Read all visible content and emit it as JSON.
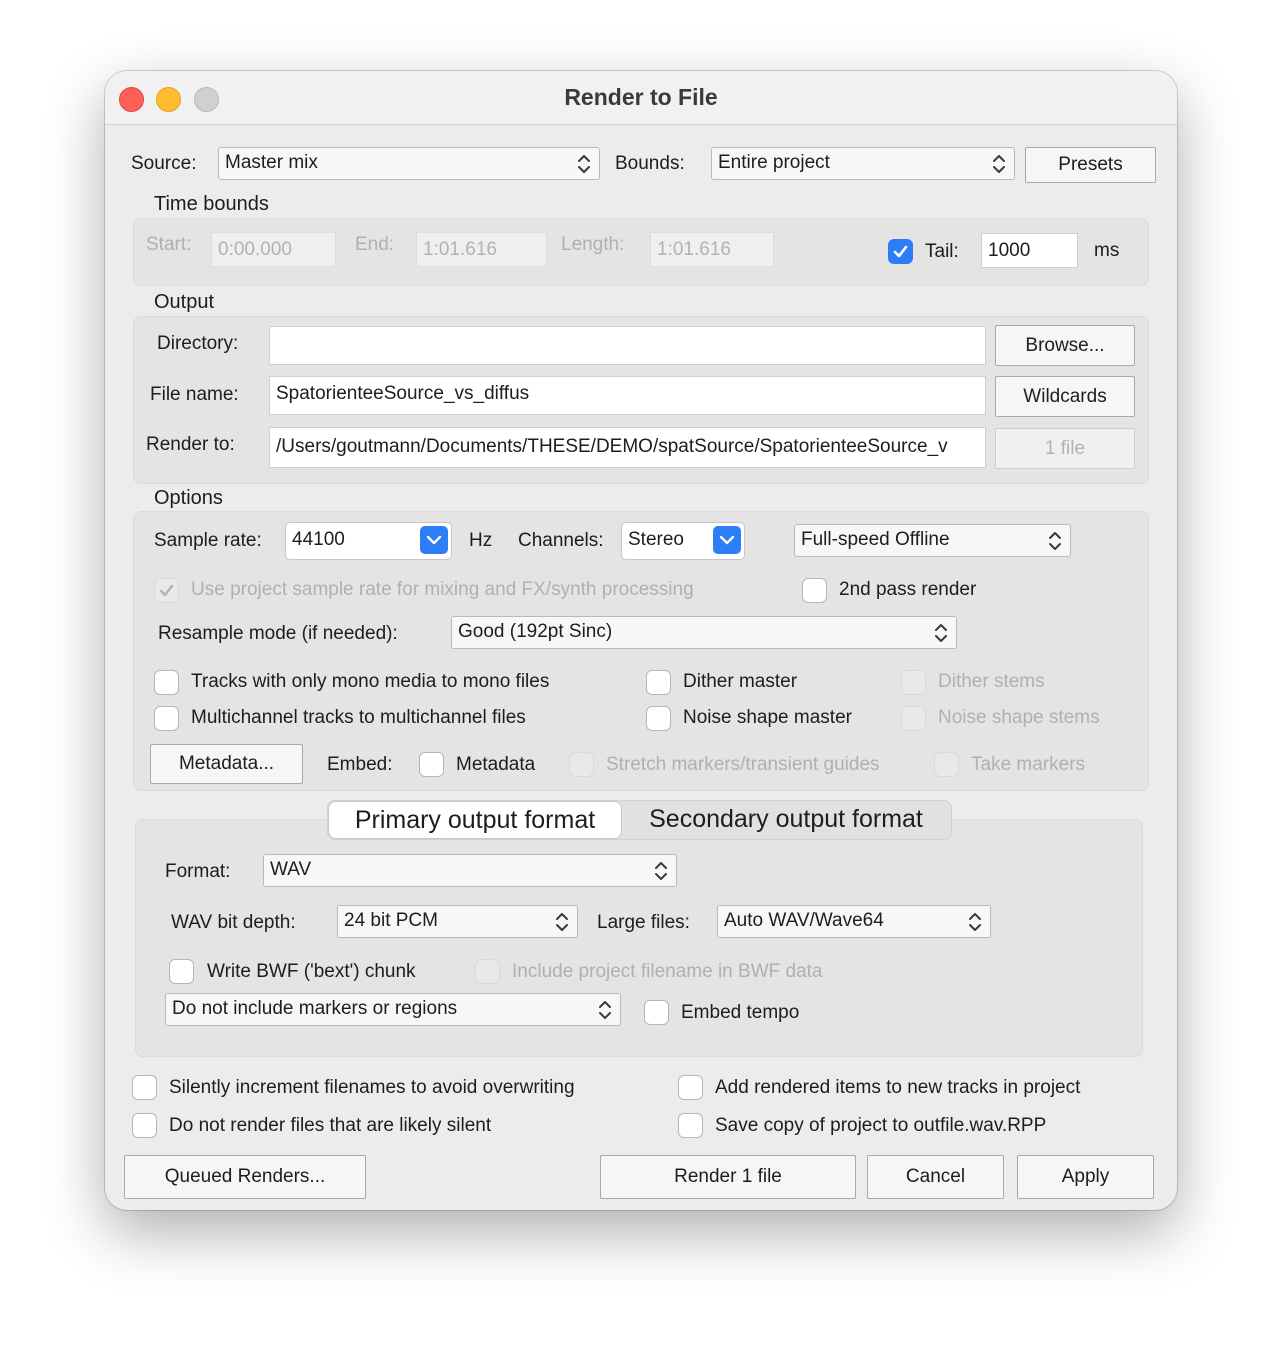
{
  "window": {
    "title": "Render to File"
  },
  "top": {
    "source_label": "Source:",
    "source_value": "Master mix",
    "bounds_label": "Bounds:",
    "bounds_value": "Entire project",
    "presets_label": "Presets"
  },
  "time_bounds": {
    "heading": "Time bounds",
    "start_label": "Start:",
    "start_value": "0:00.000",
    "end_label": "End:",
    "end_value": "1:01.616",
    "length_label": "Length:",
    "length_value": "1:01.616",
    "tail_label": "Tail:",
    "tail_checked": true,
    "tail_value": "1000",
    "tail_unit": "ms"
  },
  "output": {
    "heading": "Output",
    "directory_label": "Directory:",
    "directory_value": "",
    "browse_label": "Browse...",
    "filename_label": "File name:",
    "filename_value": "SpatorienteeSource_vs_diffus",
    "wildcards_label": "Wildcards",
    "renderto_label": "Render to:",
    "renderto_value": "/Users/goutmann/Documents/THESE/DEMO/spatSource/SpatorienteeSource_v",
    "file_count_label": "1 file"
  },
  "options": {
    "heading": "Options",
    "samplerate_label": "Sample rate:",
    "samplerate_value": "44100",
    "hz_label": "Hz",
    "channels_label": "Channels:",
    "channels_value": "Stereo",
    "speed_value": "Full-speed Offline",
    "use_project_rate_label": "Use project sample rate for mixing and FX/synth processing",
    "second_pass_label": "2nd pass render",
    "resample_label": "Resample mode (if needed):",
    "resample_value": "Good (192pt Sinc)",
    "mono_label": "Tracks with only mono media to mono files",
    "multichannel_label": "Multichannel tracks to multichannel files",
    "dither_master_label": "Dither master",
    "noise_master_label": "Noise shape master",
    "dither_stems_label": "Dither stems",
    "noise_stems_label": "Noise shape stems",
    "metadata_button": "Metadata...",
    "embed_label": "Embed:",
    "embed_metadata_label": "Metadata",
    "stretch_label": "Stretch markers/transient guides",
    "take_markers_label": "Take markers"
  },
  "format": {
    "tab_primary": "Primary output format",
    "tab_secondary": "Secondary output format",
    "format_label": "Format:",
    "format_value": "WAV",
    "bitdepth_label": "WAV bit depth:",
    "bitdepth_value": "24 bit PCM",
    "largefiles_label": "Large files:",
    "largefiles_value": "Auto WAV/Wave64",
    "bwf_label": "Write BWF ('bext') chunk",
    "include_filename_label": "Include project filename in BWF data",
    "markers_value": "Do not include markers or regions",
    "embed_tempo_label": "Embed tempo"
  },
  "bottom": {
    "silently_increment_label": "Silently increment filenames to avoid overwriting",
    "not_render_silent_label": "Do not render files that are likely silent",
    "add_items_label": "Add rendered items to new tracks in project",
    "save_copy_label": "Save copy of project to outfile.wav.RPP",
    "queued_label": "Queued Renders...",
    "render_label": "Render 1 file",
    "cancel_label": "Cancel",
    "apply_label": "Apply"
  },
  "colors": {
    "accent": "#2c7df6",
    "close": "#fe5f57",
    "minimize": "#febc2e",
    "zoom": "#d0d0d0"
  }
}
